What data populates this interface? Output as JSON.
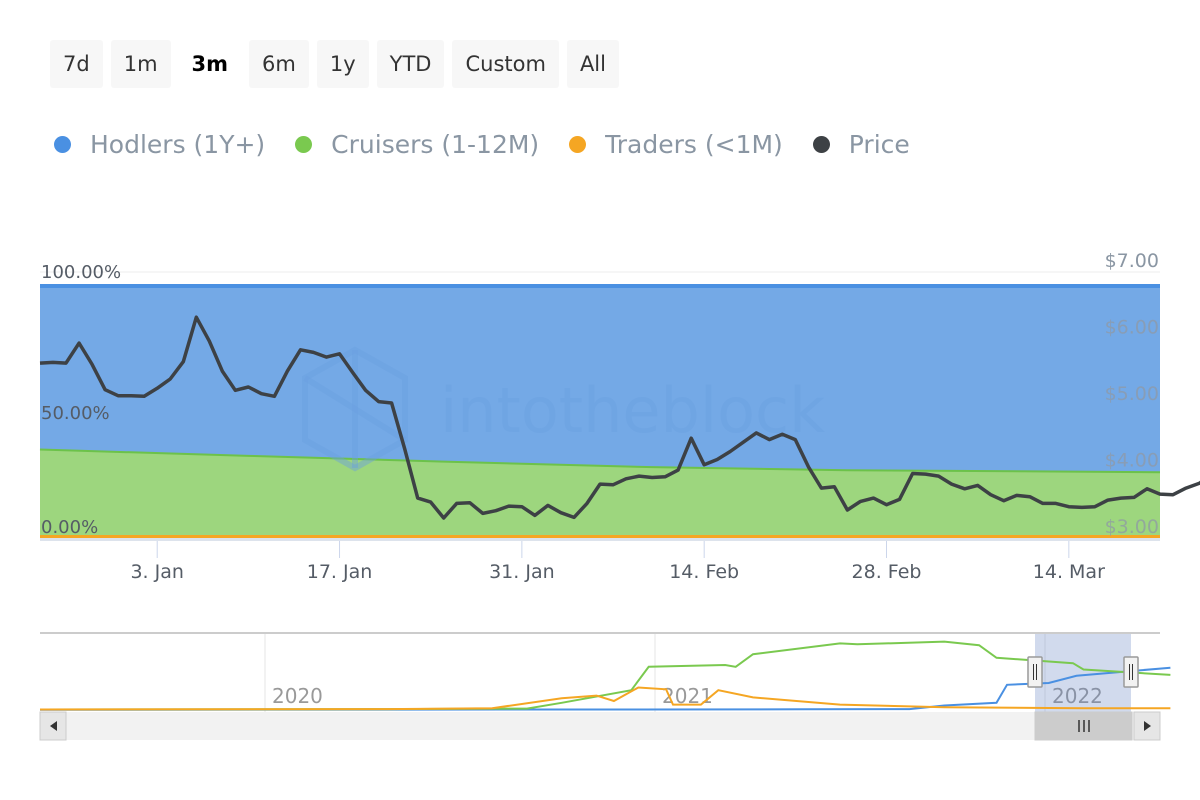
{
  "range_selector": {
    "buttons": [
      "7d",
      "1m",
      "3m",
      "6m",
      "1y",
      "YTD",
      "Custom",
      "All"
    ],
    "active": "3m"
  },
  "legend": [
    {
      "label": "Hodlers (1Y+)",
      "color": "#4a90e2"
    },
    {
      "label": "Cruisers (1-12M)",
      "color": "#7ac94f"
    },
    {
      "label": "Traders (<1M)",
      "color": "#f5a623"
    },
    {
      "label": "Price",
      "color": "#3d4145"
    }
  ],
  "watermark": "intotheblock",
  "chart_data": {
    "type": "area",
    "title": "",
    "stacking": "percent",
    "x_axis": {
      "type": "datetime",
      "range": [
        "2021-12-25",
        "2022-03-21"
      ],
      "tick_labels": [
        "3. Jan",
        "17. Jan",
        "31. Jan",
        "14. Feb",
        "28. Feb",
        "14. Mar"
      ],
      "tick_dates": [
        "2022-01-03",
        "2022-01-17",
        "2022-01-31",
        "2022-02-14",
        "2022-02-28",
        "2022-03-14"
      ]
    },
    "y_axis_left": {
      "label": "",
      "range": [
        0,
        100
      ],
      "tick_labels": [
        "0.00%",
        "50.00%",
        "100.00%"
      ],
      "ticks": [
        0,
        50,
        100
      ]
    },
    "y_axis_right": {
      "label": "",
      "range": [
        3,
        7
      ],
      "tick_labels": [
        "$3.00",
        "$4.00",
        "$5.00",
        "$6.00",
        "$7.00"
      ],
      "ticks": [
        3,
        4,
        5,
        6,
        7
      ]
    },
    "series": [
      {
        "name": "Hodlers (1Y+)",
        "type": "stacked-area-percent",
        "color": "#4a90e2",
        "fill": "#74a9e6",
        "x": [
          "2021-12-25",
          "2022-01-10",
          "2022-01-25",
          "2022-02-10",
          "2022-02-25",
          "2022-03-21"
        ],
        "values_percent": [
          64.5,
          67.0,
          69.3,
          71.5,
          72.7,
          73.5
        ]
      },
      {
        "name": "Cruisers (1-12M)",
        "type": "stacked-area-percent",
        "color": "#6cc24a",
        "fill": "#9dd67e",
        "x": [
          "2021-12-25",
          "2022-01-10",
          "2022-01-25",
          "2022-02-10",
          "2022-02-25",
          "2022-03-21"
        ],
        "values_percent": [
          34.3,
          31.8,
          29.5,
          27.3,
          26.1,
          25.3
        ]
      },
      {
        "name": "Traders (<1M)",
        "type": "stacked-area-percent",
        "color": "#f5a623",
        "fill": "#f5a623",
        "x": [
          "2021-12-25",
          "2022-01-10",
          "2022-01-25",
          "2022-02-10",
          "2022-02-25",
          "2022-03-21"
        ],
        "values_percent": [
          1.2,
          1.2,
          1.2,
          1.2,
          1.2,
          1.2
        ]
      },
      {
        "name": "Price",
        "type": "line",
        "axis": "right",
        "color": "#3d4145",
        "start_date": "2021-12-25",
        "interval_days": 1,
        "values": [
          5.45,
          5.46,
          5.45,
          5.75,
          5.43,
          5.05,
          4.96,
          4.96,
          4.95,
          5.07,
          5.21,
          5.47,
          6.14,
          5.78,
          5.33,
          5.04,
          5.09,
          4.99,
          4.95,
          5.33,
          5.65,
          5.61,
          5.54,
          5.59,
          5.31,
          5.04,
          4.87,
          4.85,
          4.16,
          3.42,
          3.36,
          3.12,
          3.34,
          3.35,
          3.19,
          3.23,
          3.3,
          3.29,
          3.16,
          3.31,
          3.2,
          3.13,
          3.34,
          3.63,
          3.62,
          3.71,
          3.75,
          3.73,
          3.74,
          3.84,
          4.32,
          3.92,
          4.0,
          4.12,
          4.26,
          4.4,
          4.3,
          4.38,
          4.3,
          3.89,
          3.57,
          3.59,
          3.24,
          3.37,
          3.42,
          3.32,
          3.4,
          3.79,
          3.78,
          3.75,
          3.63,
          3.56,
          3.61,
          3.47,
          3.38,
          3.46,
          3.44,
          3.34,
          3.34,
          3.29,
          3.28,
          3.29,
          3.39,
          3.42,
          3.43,
          3.56,
          3.48,
          3.47,
          3.57,
          3.64,
          3.77
        ]
      }
    ],
    "navigator": {
      "x_labels": [
        "2020",
        "2021",
        "2022"
      ],
      "selected_range": [
        "2021-12-25",
        "2022-03-21"
      ],
      "series": [
        {
          "name": "Hodlers (1Y+)",
          "color": "#4a90e2",
          "points": [
            [
              2019.0,
              0.2
            ],
            [
              2020.6,
              0.5
            ],
            [
              2021.2,
              0.8
            ],
            [
              2021.5,
              1.0
            ],
            [
              2021.6,
              5
            ],
            [
              2021.75,
              8
            ],
            [
              2021.78,
              28
            ],
            [
              2021.9,
              30
            ],
            [
              2021.98,
              38
            ],
            [
              2022.25,
              47
            ]
          ]
        },
        {
          "name": "Cruisers (1-12M)",
          "color": "#7ac94f",
          "points": [
            [
              2019.0,
              0.5
            ],
            [
              2020.0,
              1
            ],
            [
              2020.4,
              1.5
            ],
            [
              2020.5,
              8
            ],
            [
              2020.7,
              22
            ],
            [
              2020.75,
              48
            ],
            [
              2020.97,
              50
            ],
            [
              2021.0,
              48
            ],
            [
              2021.05,
              62
            ],
            [
              2021.3,
              74
            ],
            [
              2021.35,
              73
            ],
            [
              2021.6,
              76
            ],
            [
              2021.7,
              72
            ],
            [
              2021.75,
              58
            ],
            [
              2021.97,
              52
            ],
            [
              2022.0,
              45
            ],
            [
              2022.25,
              39
            ]
          ]
        },
        {
          "name": "Traders (<1M)",
          "color": "#f5a623",
          "points": [
            [
              2019.0,
              0.5
            ],
            [
              2020.0,
              1
            ],
            [
              2020.3,
              2
            ],
            [
              2020.5,
              13
            ],
            [
              2020.6,
              16
            ],
            [
              2020.65,
              10
            ],
            [
              2020.72,
              25
            ],
            [
              2020.8,
              23
            ],
            [
              2020.82,
              6
            ],
            [
              2020.9,
              6
            ],
            [
              2020.95,
              22
            ],
            [
              2021.05,
              14
            ],
            [
              2021.3,
              6
            ],
            [
              2021.6,
              3
            ],
            [
              2022.0,
              2
            ],
            [
              2022.25,
              2
            ]
          ]
        }
      ]
    }
  }
}
